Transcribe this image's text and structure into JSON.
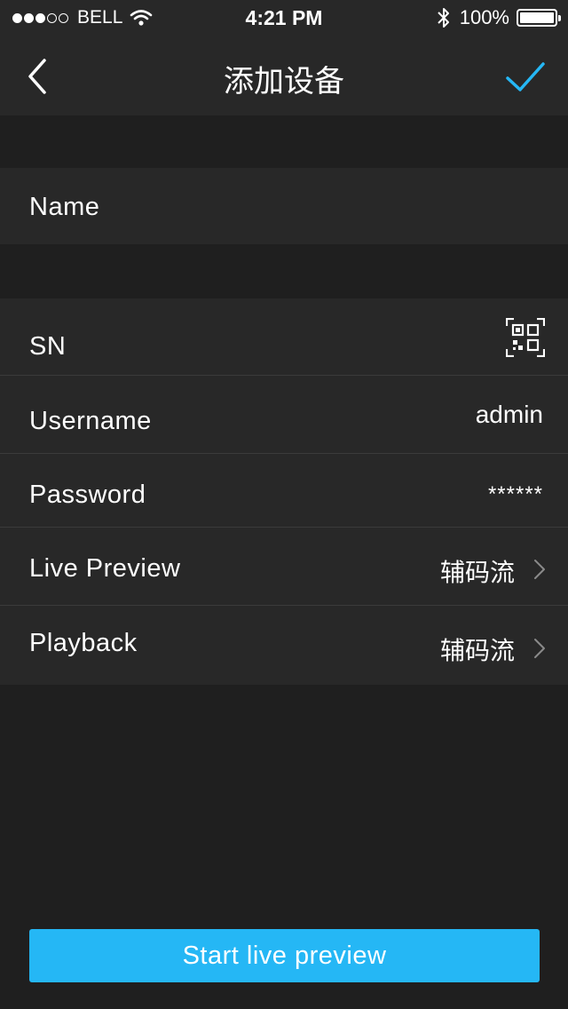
{
  "status_bar": {
    "carrier": "BELL",
    "time": "4:21 PM",
    "battery_percent": "100%",
    "signal_strength": 3,
    "signal_total": 5
  },
  "nav": {
    "title": "添加设备",
    "back_icon": "chevron-left-icon",
    "confirm_icon": "checkmark-icon",
    "accent_color": "#25b7f5"
  },
  "fields": {
    "name_label": "Name",
    "sn_label": "SN",
    "username_label": "Username",
    "username_value": "admin",
    "password_label": "Password",
    "password_value": "******",
    "live_preview_label": "Live Preview",
    "live_preview_value": "辅码流",
    "playback_label": "Playback",
    "playback_value": "辅码流"
  },
  "actions": {
    "start_label": "Start live preview",
    "button_color": "#25b7f5"
  }
}
